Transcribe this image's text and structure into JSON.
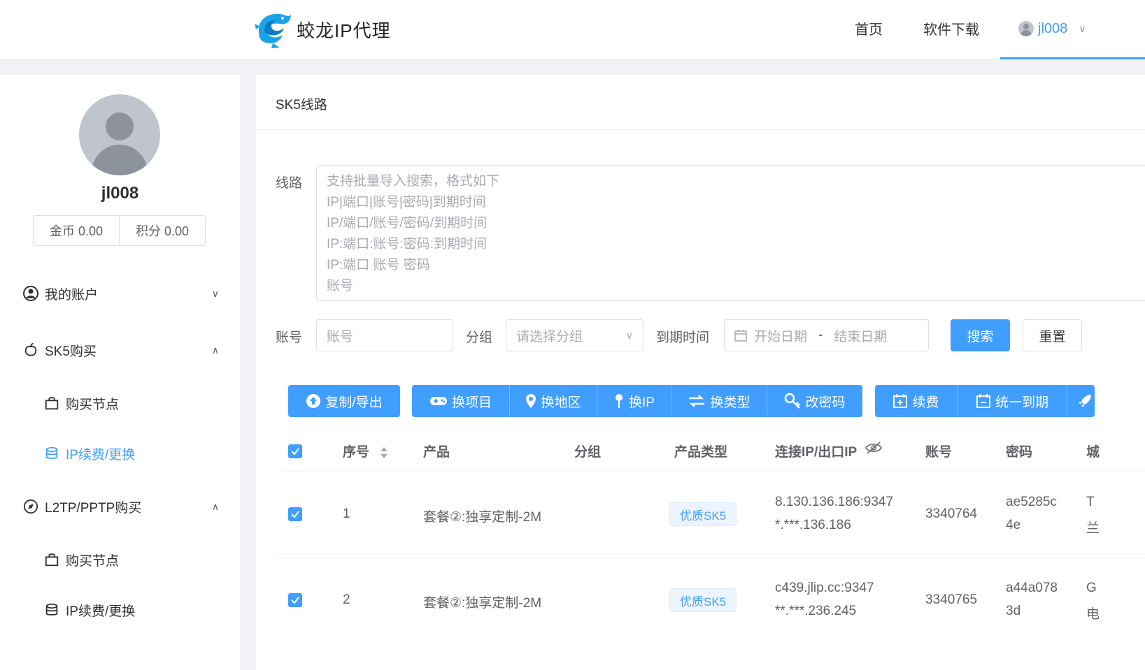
{
  "header": {
    "brand": "蛟龙IP代理",
    "nav": [
      {
        "label": "首页"
      },
      {
        "label": "软件下载"
      }
    ],
    "user": "jl008"
  },
  "sidebar": {
    "username": "jl008",
    "coins": "金币 0.00",
    "points": "积分 0.00",
    "menu": [
      {
        "label": "我的账户",
        "icon": "user-circle-icon"
      },
      {
        "label": "SK5购买",
        "icon": "apple-icon"
      },
      {
        "label": "购买节点",
        "icon": "bag-icon"
      },
      {
        "label": "IP续费/更换",
        "icon": "coin-stack-icon"
      },
      {
        "label": "L2TP/PPTP购买",
        "icon": "compass-icon"
      },
      {
        "label": "购买节点",
        "icon": "bag-icon"
      },
      {
        "label": "IP续费/更换",
        "icon": "coin-stack-icon"
      }
    ]
  },
  "main": {
    "title": "SK5线路",
    "line_label": "线路",
    "textarea_placeholder": [
      "支持批量导入搜索，格式如下",
      "IP|端口|账号|密码|到期时间",
      "IP/端口/账号/密码/到期时间",
      "IP:端口:账号:密码:到期时间",
      "IP:端口 账号 密码",
      "账号"
    ],
    "account_label": "账号",
    "account_placeholder": "账号",
    "group_label": "分组",
    "group_placeholder": "请选择分组",
    "expire_label": "到期时间",
    "start_date_placeholder": "开始日期",
    "date_separator": "-",
    "end_date_placeholder": "结束日期",
    "search_btn": "搜索",
    "reset_btn": "重置",
    "toolbar": {
      "copy_export": "复制/导出",
      "change_project": "换项目",
      "change_region": "换地区",
      "change_ip": "换IP",
      "change_type": "换类型",
      "change_password": "改密码",
      "renew": "续费",
      "unify_expire": "统一到期"
    },
    "table": {
      "headers": {
        "index": "序号",
        "product": "产品",
        "group": "分组",
        "product_type": "产品类型",
        "connect_ip": "连接IP/出口IP",
        "account": "账号",
        "password": "密码",
        "city": "城"
      },
      "rows": [
        {
          "index": "1",
          "product": "套餐②:独享定制-2M",
          "type": "优质SK5",
          "ip1": "8.130.136.186:9347",
          "ip2": "*.***.136.186",
          "account": "3340764",
          "pw1": "ae5285c",
          "pw2": "4e",
          "city1": "T",
          "city2": "兰"
        },
        {
          "index": "2",
          "product": "套餐②:独享定制-2M",
          "type": "优质SK5",
          "ip1": "c439.jlip.cc:9347",
          "ip2": "**.***.236.245",
          "account": "3340765",
          "pw1": "a44a078",
          "pw2": "3d",
          "city1": "G",
          "city2": "电"
        }
      ]
    }
  },
  "colors": {
    "accent": "#409eff",
    "background": "#f0f2f5"
  }
}
